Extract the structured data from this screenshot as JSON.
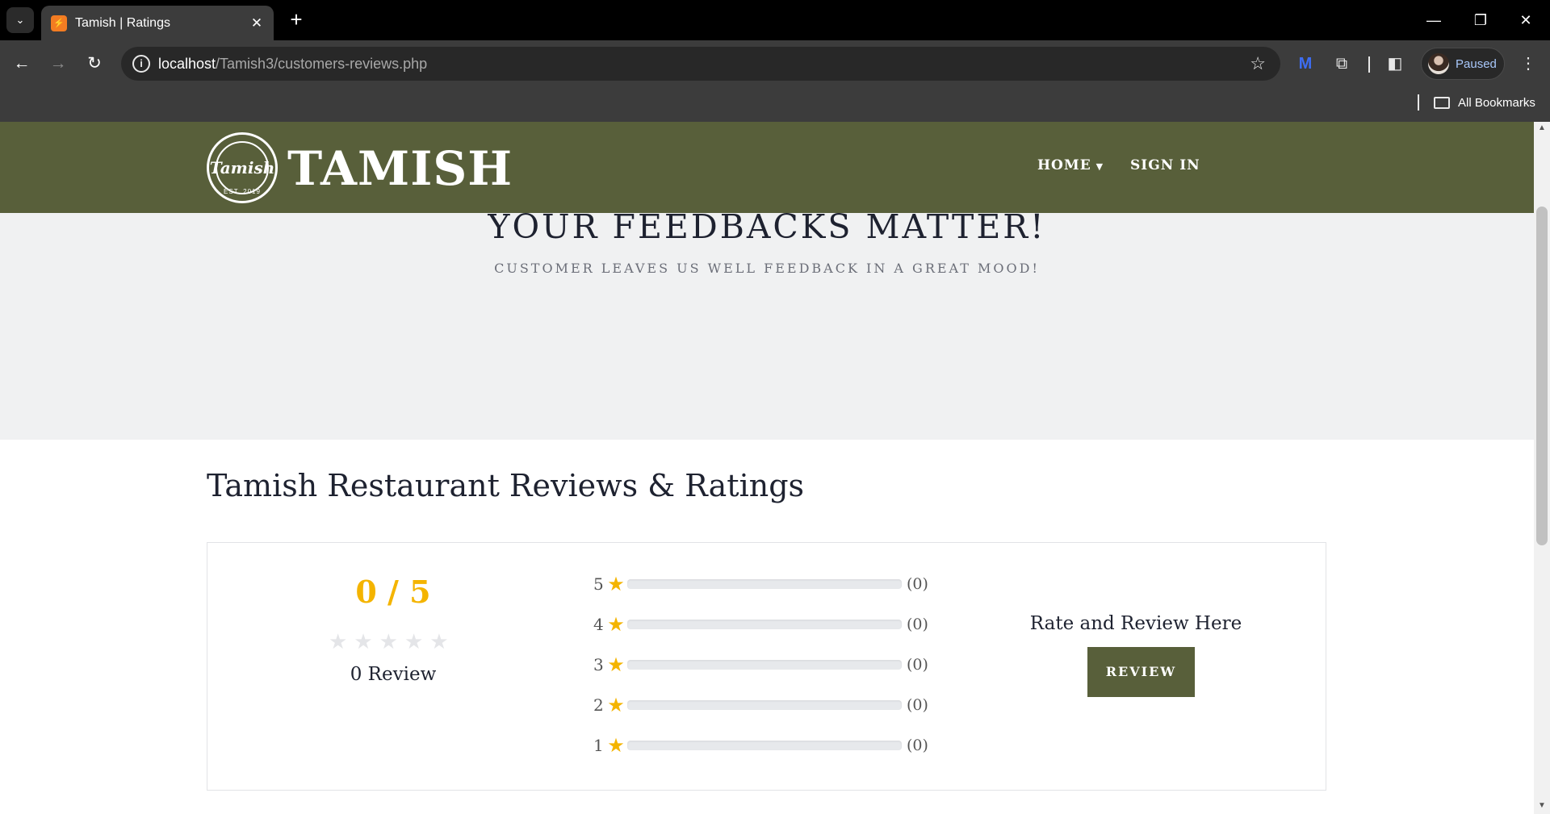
{
  "browser": {
    "tab_title": "Tamish | Ratings",
    "favicon_text": "⚡",
    "url_host": "localhost",
    "url_path": "/Tamish3/customers-reviews.php",
    "profile_label": "Paused",
    "bookmarks_label": "All Bookmarks"
  },
  "site": {
    "brand": "TAMISH",
    "emblem_script": "Tamish",
    "emblem_est": "EST. 2019",
    "nav": {
      "home": "HOME",
      "signin": "SIGN IN"
    },
    "hero_title": "YOUR FEEDBACKS MATTER!",
    "hero_subtitle": "CUSTOMER LEAVES US WELL FEEDBACK IN A GREAT MOOD!",
    "section_title": "Tamish Restaurant Reviews & Ratings"
  },
  "rating": {
    "score": "0 / 5",
    "filled_stars": 0,
    "review_count": "0 Review",
    "bars": [
      {
        "stars": "5",
        "count": "(0)",
        "fraction": 0
      },
      {
        "stars": "4",
        "count": "(0)",
        "fraction": 0
      },
      {
        "stars": "3",
        "count": "(0)",
        "fraction": 0
      },
      {
        "stars": "2",
        "count": "(0)",
        "fraction": 0
      },
      {
        "stars": "1",
        "count": "(0)",
        "fraction": 0
      }
    ],
    "cta_label": "Rate and Review Here",
    "button_label": "REVIEW"
  },
  "colors": {
    "brand_olive": "#585f3a",
    "star_gold": "#f4b400",
    "page_bg": "#f0f1f2"
  }
}
